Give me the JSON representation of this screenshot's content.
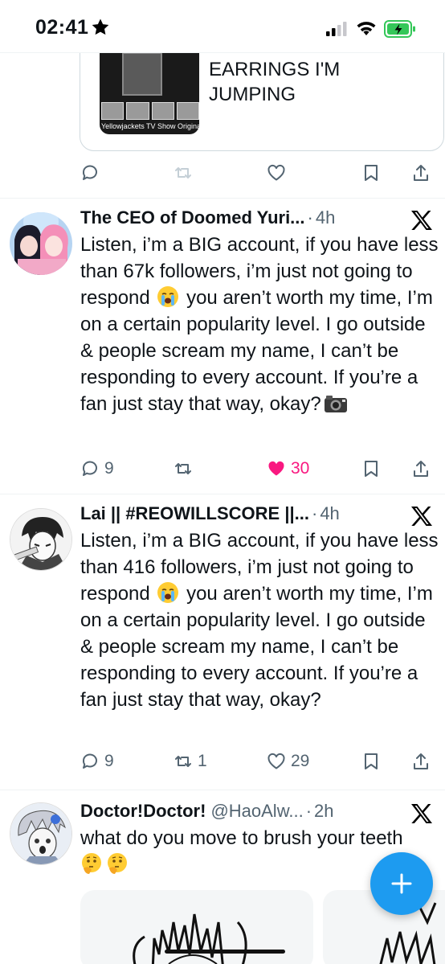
{
  "status_bar": {
    "time": "02:41"
  },
  "card_preview": {
    "title": "EARRINGS I'M JUMPING",
    "thumb_caption": "Yellowjackets TV Show Original"
  },
  "tweets": [
    {
      "name": "The CEO of Doomed Yuri...",
      "handle": "",
      "time": "4h",
      "body_before_emoji": "Listen, i’m a BIG account, if you have less than 67k followers, i’m just not going to respond ",
      "body_after_emoji": " you aren’t worth my time, I’m on a certain popularity level. I go outside & people scream my name, I can’t be responding to every account. If you’re a fan just stay that way, okay?",
      "replies": "9",
      "retweets": "",
      "likes": "30",
      "liked": true
    },
    {
      "name": "Lai || #REOWILLSCORE ||...",
      "handle": "",
      "time": "4h",
      "body_before_emoji": "Listen, i’m a BIG account, if you have less than 416 followers, i’m just not going to respond ",
      "body_after_emoji": " you aren’t worth my time, I’m on a certain popularity level. I go outside & people scream my name, I can’t be responding to every account. If you’re a fan just stay that way, okay?",
      "replies": "9",
      "retweets": "1",
      "likes": "29",
      "liked": false
    },
    {
      "name": "Doctor!Doctor!",
      "handle": "@HaoAlw...",
      "time": "2h",
      "body": "what do you move to brush your teeth"
    }
  ],
  "icons": {
    "reply": "reply-icon",
    "retweet": "retweet-icon",
    "like": "heart-icon",
    "bookmark": "bookmark-icon",
    "share": "share-icon",
    "x_logo": "x-logo-icon",
    "compose": "compose-plus-icon"
  },
  "colors": {
    "accent": "#1d9bf0",
    "like": "#f91880",
    "muted": "#536471",
    "text": "#0f1419",
    "battery": "#34c759"
  }
}
